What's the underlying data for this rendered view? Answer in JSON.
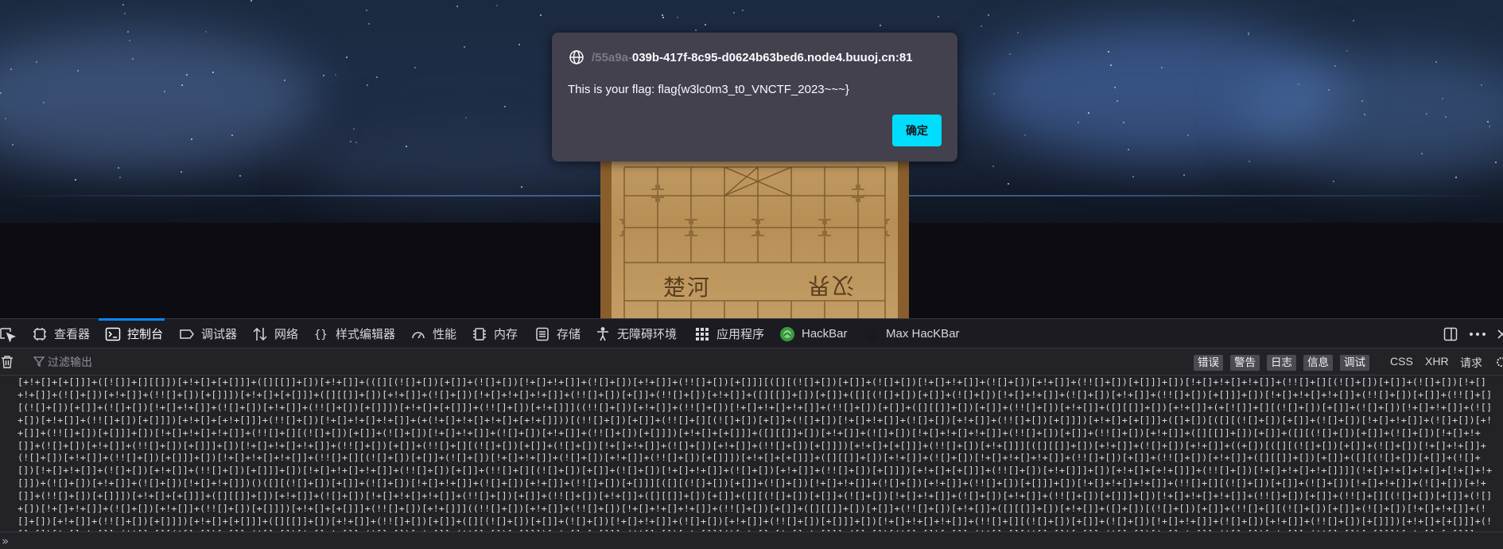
{
  "alert": {
    "origin_faded": "/55a9a-",
    "origin": "039b-417f-8c95-d0624b63bed6.node4.buuoj.cn:81",
    "message": "This is your flag: flag{w3lc0m3_t0_VNCTF_2023~~~}",
    "ok_label": "确定"
  },
  "board": {
    "river_left": "楚河",
    "river_right": "汉界"
  },
  "devtools": {
    "tabs": [
      {
        "label": "查看器",
        "icon": "inspector-icon"
      },
      {
        "label": "控制台",
        "icon": "console-icon"
      },
      {
        "label": "调试器",
        "icon": "debugger-icon"
      },
      {
        "label": "网络",
        "icon": "network-icon"
      },
      {
        "label": "样式编辑器",
        "icon": "style-editor-icon"
      },
      {
        "label": "性能",
        "icon": "performance-icon"
      },
      {
        "label": "内存",
        "icon": "memory-icon"
      },
      {
        "label": "存储",
        "icon": "storage-icon"
      },
      {
        "label": "无障碍环境",
        "icon": "accessibility-icon"
      },
      {
        "label": "应用程序",
        "icon": "application-icon"
      },
      {
        "label": "HackBar",
        "icon": "hackbar-icon"
      },
      {
        "label": "Max HacKBar",
        "icon": "lock-icon"
      }
    ],
    "active_tab": "控制台",
    "filter_placeholder": "过滤输出",
    "levels": [
      "错误",
      "警告",
      "日志",
      "信息",
      "调试"
    ],
    "request_filters": [
      "CSS",
      "XHR",
      "请求"
    ],
    "console_output": "[+!+[]+[+[]]]+([![]]+[][[]])[+!+[]+[+[]]]+([][[]]+[])[+!+[]]+(([][(![]+[])[+[]]+(![]+[])[!+[]+!+[]]+(![]+[])[+!+[]]+(!![]+[])[+[]]][([][(![]+[])[+[]]+(![]+[])[!+[]+!+[]]+(![]+[])[+!+[]]+(!![]+[])[+[]]]+[])[!+[]+!+[]+!+[]]+(!![]+[][(![]+[])[+[]]+(![]+[])[!+[]+!+[]]+(![]+[])[+!+[]]+(!![]+[])[+[]]])[+!+[]+[+[]]]+([][[]]+[])[+!+[]]+(![]+[])[!+[]+!+[]+!+[]]+(!![]+[])[+[]]+(!![]+[])[+!+[]]+([][[]]+[])[+[]]+([][(![]+[])[+[]]+(![]+[])[!+[]+!+[]]+(![]+[])[+!+[]]+(!![]+[])[+[]]]+[])[!+[]+!+[]+!+[]]+(!![]+[])[+[]]+(!![]+[][(![]+[])[+[]]+(![]+[])[!+[]+!+[]]+(![]+[])[+!+[]]+(!![]+[])[+[]]])[+!+[]+[+[]]]+(!![]+[])[+!+[]]]((!![]+[])[+!+[]]+(!![]+[])[!+[]+!+[]+!+[]]+(!![]+[])[+[]]+([][[]]+[])[+[]]+(!![]+[])[+!+[]]+([][[]]+[])[+!+[]]+(+[![]]+[][(![]+[])[+[]]+(![]+[])[!+[]+!+[]]+(![]+[])[+!+[]]+(!![]+[])[+[]]])[+!+[]+[+!+[]]]+(!![]+[])[!+[]+!+[]+!+[]]+(+(!+[]+!+[]+!+[]+[+!+[]]))[(!![]+[])[+[]]+(!![]+[][(![]+[])[+[]]+(![]+[])[!+[]+!+[]]+(![]+[])[+!+[]]+(!![]+[])[+[]]])[+!+[]+[+[]]]+([]+[])[([][(![]+[])[+[]]+(![]+[])[!+[]+!+[]]+(![]+[])[+!+[]]+(!![]+[])[+[]]]+[])[!+[]+!+[]+!+[]]+(!![]+[][(![]+[])[+[]]+(![]+[])[!+[]+!+[]]+(![]+[])[+!+[]]+(!![]+[])[+[]]])[+!+[]+[+[]]]+([][[]]+[])[+!+[]]+(![]+[])[!+[]+!+[]+!+[]]+(!![]+[])[+[]]+(!![]+[])[+!+[]]+([][[]]+[])[+[]]+([][(![]+[])[+[]]+(![]+[])[!+[]+!+[]]+(![]+[])[+!+[]]+(!![]+[])[+[]]]+[])[!+[]+!+[]+!+[]]+(!![]+[])[+[]]+(!![]+[][(![]+[])[+[]]+(![]+[])[!+[]+!+[]]+(![]+[])[+!+[]]+(!![]+[])[+[]]])[+!+[]+[+[]]]+(!![]+[])[+!+[]]][([][[]]+[])[+!+[]]+(![]+[])[+!+[]]+((+[])[([][(![]+[])[+[]]+(![]+[])[!+[]+!+[]]+(![]+[])[+!+[]]+(!![]+[])[+[]]]+[])[!+[]+!+[]+!+[]]+(!![]+[][(![]+[])[+[]]+(![]+[])[!+[]+!+[]]+(![]+[])[+!+[]]+(!![]+[])[+[]]])[+!+[]+[+[]]]+([][[]]+[])[+!+[]]+(![]+[])[!+[]+!+[]+!+[]]+(!![]+[])[+[]]+(!![]+[])[+!+[]]+([][[]]+[])[+[]]+([][(![]+[])[+[]]+(![]+[])[!+[]+!+[]]+(![]+[])[+!+[]]+(!![]+[])[+[]]]+[])[!+[]+!+[]+!+[]]+(!![]+[])[+[]]+(!![]+[][(![]+[])[+[]]+(![]+[])[!+[]+!+[]]+(![]+[])[+!+[]]+(!![]+[])[+[]]])[+!+[]+[+[]]]+(!![]+[])[+!+[]]]+[])[+!+[]+[+!+[]]]+(!![]+[])[!+[]+!+[]+!+[]]]](!+[]+!+[]+!+[]+[!+[]+!+[]])+(![]+[])[+!+[]]+(![]+[])[!+[]+!+[]])()([][(![]+[])[+[]]+(![]+[])[!+[]+!+[]]+(![]+[])[+!+[]]+(!![]+[])[+[]]][([][(![]+[])[+[]]+(![]+[])[!+[]+!+[]]+(![]+[])[+!+[]]+(!![]+[])[+[]]]+[])[!+[]+!+[]+!+[]]+(!![]+[][(![]+[])[+[]]+(![]+[])[!+[]+!+[]]+(![]+[])[+!+[]]+(!![]+[])[+[]]])[+!+[]+[+[]]]+([][[]]+[])[+!+[]]+(![]+[])[!+[]+!+[]+!+[]]+(!![]+[])[+[]]+(!![]+[])[+!+[]]+([][[]]+[])[+[]]+([][(![]+[])[+[]]+(![]+[])[!+[]+!+[]]+(![]+[])[+!+[]]+(!![]+[])[+[]]]+[])[!+[]+!+[]+!+[]]+(!![]+[])[+[]]+(!![]+[][(![]+[])[+[]]+(![]+[])[!+[]+!+[]]+(![]+[])[+!+[]]+(!![]+[])[+[]]])[+!+[]+[+[]]]+(!![]+[])[+!+[]]]((!![]+[])[+!+[]]+(!![]+[])[!+[]+!+[]+!+[]]+(!![]+[])[+[]]+([][[]]+[])[+[]]+(!![]+[])[+!+[]]+([][[]]+[])[+!+[]]+([]+[])[(![]+[])[+[]]+(!![]+[][(![]+[])[+[]]+(![]+[])[!+[]+!+[]]+(![]+[])[+!+[]]+(!![]+[])[+[]]])[+!+[]+[+[]]]+([][[]]+[])[+!+[]]+(!![]+[])[+[]]+([][(![]+[])[+[]]+(![]+[])[!+[]+!+[]]+(![]+[])[+!+[]]+(!![]+[])[+[]]]+[])[!+[]+!+[]+!+[]]+(!![]+[][(![]+[])[+[]]+(![]+[])[!+[]+!+[]]+(![]+[])[+!+[]]+(!![]+[])[+[]]])[+!+[]+[+[]]]+(![]+[])[!+[]+!+[]]+(!![]+[][(![]+[])[+[]]+(![]+[])[!+[]+!+[]]+(![]+[])[+!+[]]+(!![]+[])[+[]]])[+!+[]+[+[]]]+(!![]+[])[+!+[]]]()[+!+[]+[!+[]+!+[]]]+([]+[])[(![]+[])[+[]]+(!![]+[][(![]+[])[+[]]+(![]+[])[!+[]+!+[]]+(![]+[])[+!+[]]+(!![]+[])[+[]]])[+!+[]+[+[]]]+([][[]]+[])[+!+[]]+(!![]+[])[+[]]+([][(![]+[])[+[]]+(![]+[])[!+[]+!+[]]+(![]+[])[+!+[]]+(!![]+[])[+[]]]+[])[!+[]+!+[]+!+[]]+(!![]+[][(![]+[])[+[]]+(![]+[])[!+[]+!+[]]+(![]+[])[+!+[]]+(!![]+[])[+[]]])[+!+[]+[+[]]]+(![]+[])[!+[]+!+[]]+(!![]+[][(![]+[])[+[]]+(![]+[])[!+[]+!+[]]+(![]+[])[+!+[]]+(!![]+[])[+[]]])[+!+[]+[+[]]]+(!![]+[])[+!+[]]]()[+!+[]+[!+[]+!+[]]])())"
  }
}
